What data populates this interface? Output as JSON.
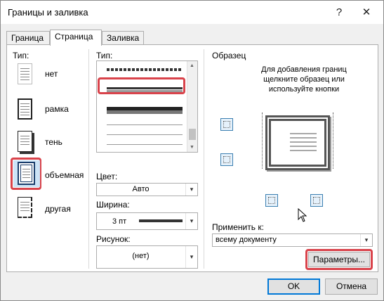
{
  "window": {
    "title": "Границы и заливка",
    "help_glyph": "?",
    "close_glyph": "✕"
  },
  "tabs": [
    {
      "label": "Граница"
    },
    {
      "label": "Страница"
    },
    {
      "label": "Заливка"
    }
  ],
  "setting": {
    "label": "Тип:",
    "items": [
      {
        "label": "нет"
      },
      {
        "label": "рамка"
      },
      {
        "label": "тень"
      },
      {
        "label": "объемная"
      },
      {
        "label": "другая"
      }
    ]
  },
  "style": {
    "label": "Тип:",
    "color_label": "Цвет:",
    "color_value": "Авто",
    "width_label": "Ширина:",
    "width_value": "3 пт",
    "art_label": "Рисунок:",
    "art_value": "(нет)"
  },
  "preview": {
    "label": "Образец",
    "instruction": "Для добавления границ щелкните образец или используйте кнопки",
    "apply_label": "Применить к:",
    "apply_value": "всему документу",
    "options_button": "Параметры..."
  },
  "footer": {
    "ok": "OK",
    "cancel": "Отмена"
  },
  "colors": {
    "highlight": "#d9434b",
    "accent": "#3c7fb1"
  },
  "icons": {
    "dropdown": "chevron-down-icon",
    "scroll_up": "▲",
    "scroll_down": "▼",
    "arrow": "▾"
  }
}
